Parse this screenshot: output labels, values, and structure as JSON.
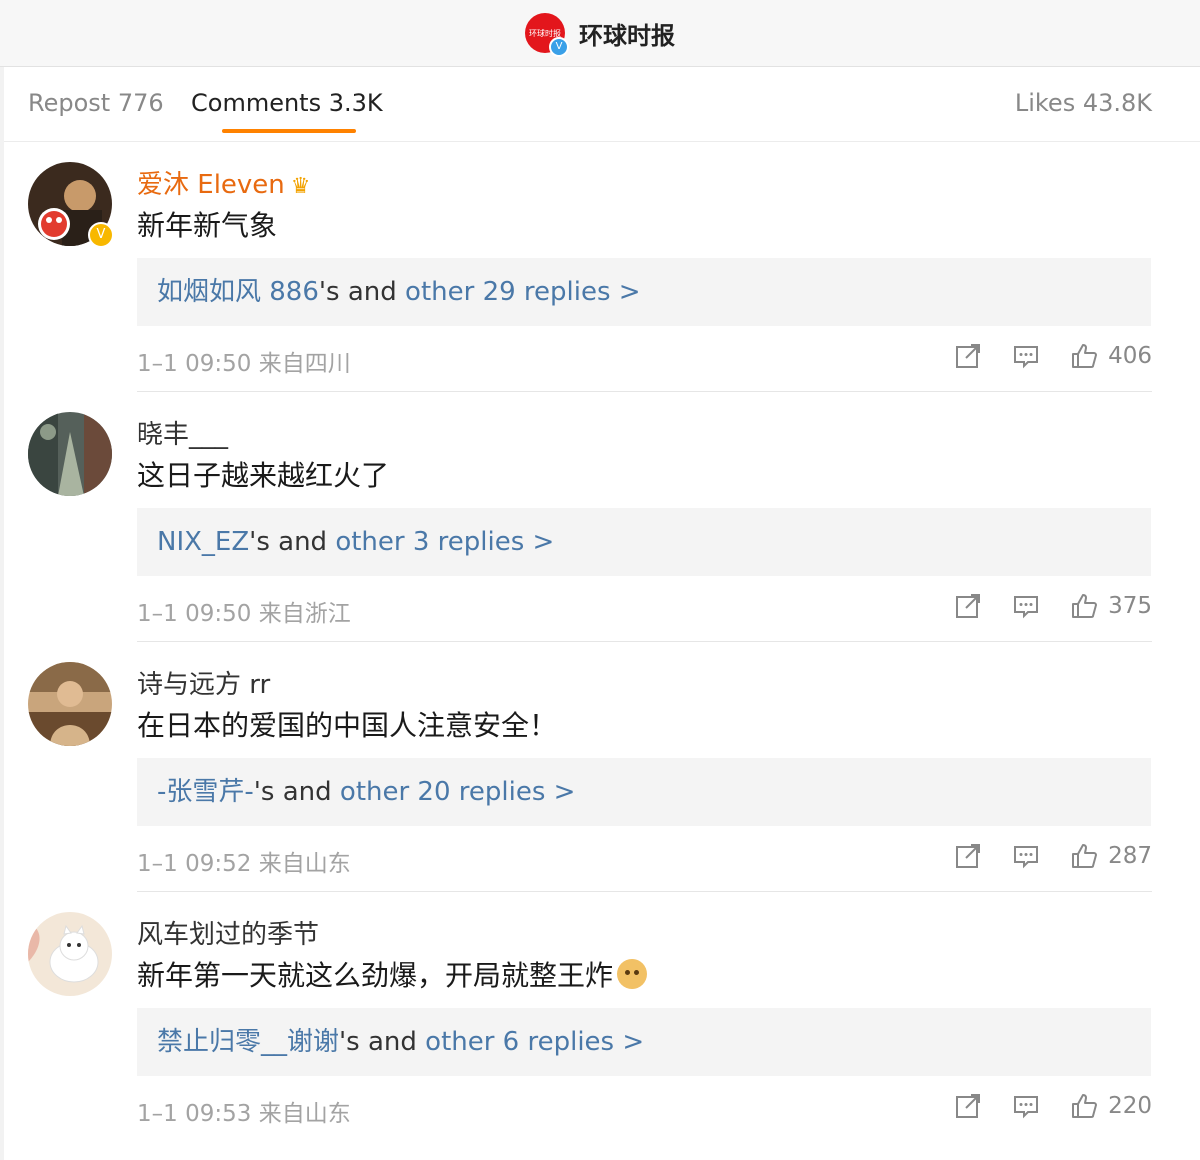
{
  "header": {
    "account_name": "环球时报",
    "logo_text": "环球时报",
    "verified_mark": "V"
  },
  "tabs": {
    "repost": "Repost 776",
    "comments": "Comments 3.3K",
    "likes": "Likes 43.8K"
  },
  "comments": [
    {
      "username": "爱沐 Eleven",
      "vip": true,
      "content": "新年新气象",
      "reply_user": "如烟如风 886",
      "reply_mid": "'s and ",
      "reply_more": "other 29 replies >",
      "time": "1–1 09:50",
      "location": "来自四川",
      "likes": "406",
      "avatar_colors": [
        "#3b2a1e",
        "#c89a6a"
      ]
    },
    {
      "username": "晓丰___",
      "vip": false,
      "content": "这日子越来越红火了",
      "reply_user": "NIX_EZ",
      "reply_mid": "'s and ",
      "reply_more": "other 3 replies >",
      "time": "1–1 09:50",
      "location": "来自浙江",
      "likes": "375",
      "avatar_colors": [
        "#55605a",
        "#a9b4a0"
      ]
    },
    {
      "username": "诗与远方 rr",
      "vip": false,
      "content": "在日本的爱国的中国人注意安全！",
      "reply_user": "-张雪芹-",
      "reply_mid": "'s and ",
      "reply_more": "other 20 replies >",
      "time": "1–1 09:52",
      "location": "来自山东",
      "likes": "287",
      "avatar_colors": [
        "#7a5a3a",
        "#d6b48a"
      ]
    },
    {
      "username": "风车划过的季节",
      "vip": false,
      "content": "新年第一天就这么劲爆，开局就整王炸",
      "reply_user": "禁止归零__谢谢",
      "reply_mid": "'s and ",
      "reply_more": "other 6 replies >",
      "time": "1–1 09:53",
      "location": "来自山东",
      "likes": "220",
      "avatar_colors": [
        "#f3e7d8",
        "#ffffff"
      ]
    }
  ],
  "icons": {
    "share": "share-icon",
    "comment": "comment-icon",
    "like": "thumbs-up-icon"
  },
  "colors": {
    "accent": "#ff8200",
    "link": "#4a78a8",
    "vip_name": "#e86a10"
  }
}
